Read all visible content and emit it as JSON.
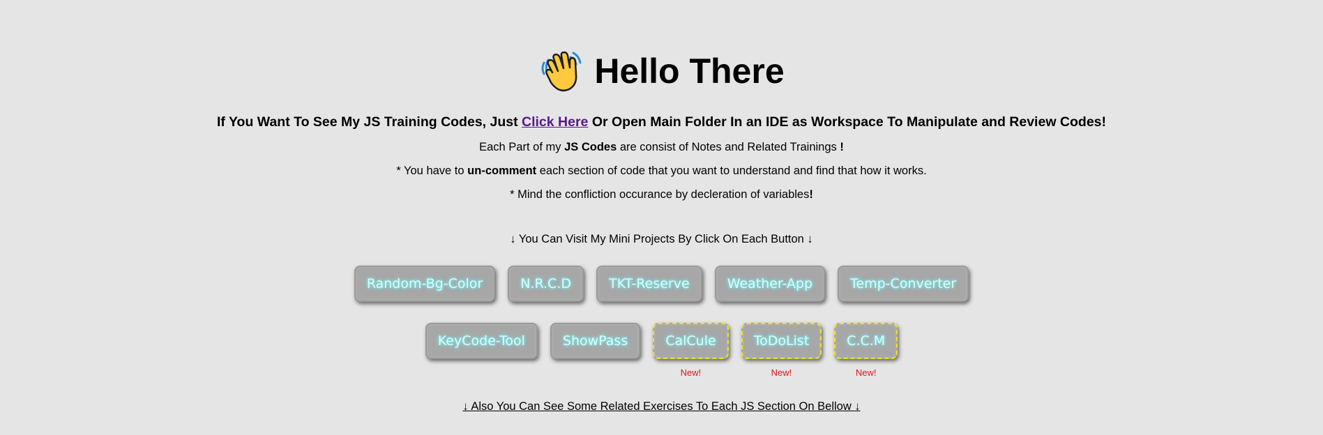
{
  "header": {
    "title": "Hello There",
    "icon": "waving-hand-icon"
  },
  "intro": {
    "before": "If You Want To See My JS Training Codes, Just ",
    "link": "Click Here",
    "after": " Or Open Main Folder In an IDE as Workspace To Manipulate and Review Codes!"
  },
  "notes": {
    "line1_a": "Each Part of my ",
    "line1_b": "JS Codes",
    "line1_c": " are consist of Notes and Related Trainings ",
    "line1_d": "!",
    "line2_a": "* You have to ",
    "line2_b": "un-comment",
    "line2_c": " each section of code that you want to understand and find that how it works.",
    "line3_a": "* Mind the confliction occurance by decleration of variables",
    "line3_b": "!"
  },
  "projects_heading": "↓ You Can Visit My Mini Projects By Click On Each Button ↓",
  "projects": {
    "row1": [
      {
        "label": "Random-Bg-Color"
      },
      {
        "label": "N.R.C.D"
      },
      {
        "label": "TKT-Reserve"
      },
      {
        "label": "Weather-App"
      },
      {
        "label": "Temp-Converter"
      }
    ],
    "row2": [
      {
        "label": "KeyCode-Tool"
      },
      {
        "label": "ShowPass"
      },
      {
        "label": "CalCule",
        "badge": "New!"
      },
      {
        "label": "ToDoList",
        "badge": "New!"
      },
      {
        "label": "C.C.M",
        "badge": "New!"
      }
    ]
  },
  "exercises_link": "↓ Also You Can See Some Related Exercises To Each JS Section On Bellow ↓",
  "colors": {
    "background": "#e5e5e5",
    "button_bg": "#a7a7a7",
    "button_text_glow": "#7ff5f5",
    "new_border": "#f0e21a",
    "new_badge": "#e0141e",
    "link_visited": "#551a8b"
  }
}
